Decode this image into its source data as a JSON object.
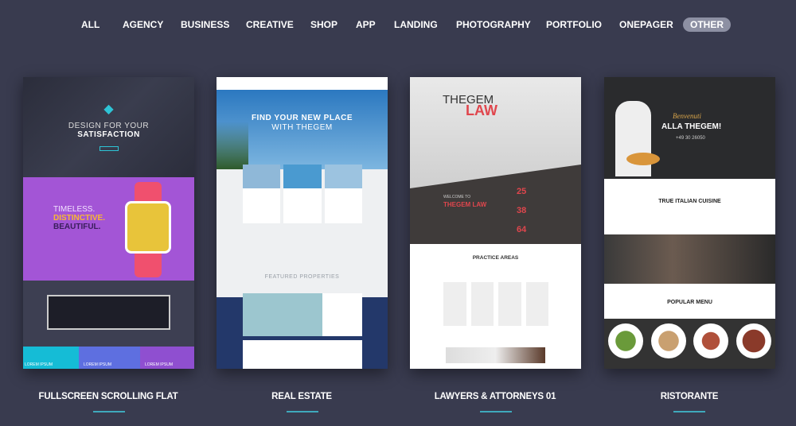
{
  "filters": {
    "items": [
      "ALL",
      "AGENCY",
      "BUSINESS",
      "CREATIVE",
      "SHOP",
      "APP",
      "LANDING",
      "PHOTOGRAPHY",
      "PORTFOLIO",
      "ONEPAGER",
      "OTHER"
    ],
    "active": "OTHER"
  },
  "cards": [
    {
      "title": "FULLSCREEN SCROLLING FLAT",
      "hero1": "DESIGN FOR YOUR",
      "hero2": "SATISFACTION",
      "s1": "TIMELESS.",
      "s2": "DISTINCTIVE.",
      "s3": "BEAUTIFUL.",
      "tiles": [
        "LOREM IPSUM",
        "LOREM IPSUM",
        "LOREM IPSUM"
      ]
    },
    {
      "title": "REAL ESTATE",
      "hero1": "FIND YOUR NEW PLACE",
      "hero2": "WITH THEGEM",
      "section": "FEATURED PROPERTIES"
    },
    {
      "title": "LAWYERS & ATTORNEYS 01",
      "hero1": "THEGEM",
      "hero2": "LAW",
      "welcome": "WELCOME TO",
      "welcome2": "THEGEM LAW",
      "stats": [
        "25",
        "38",
        "64"
      ],
      "section": "PRACTICE AREAS"
    },
    {
      "title": "RISTORANTE",
      "script1": "Benvenuti",
      "hero": "ALLA THEGEM!",
      "phone": "+49 30 26050",
      "section1": "TRUE ITALIAN CUISINE",
      "section2": "POPULAR MENU"
    }
  ],
  "colors": {
    "background": "#393b4f",
    "accent": "#3fa9bc",
    "active_pill": "#8d90a3"
  }
}
